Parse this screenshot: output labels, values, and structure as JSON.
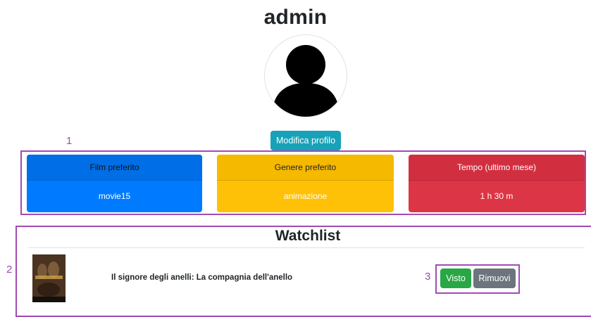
{
  "profile": {
    "username": "admin",
    "edit_label": "Modifica profilo"
  },
  "annotations": [
    "1",
    "2",
    "3"
  ],
  "stats": [
    {
      "label": "Film preferito",
      "value": "movie15",
      "color": "#007bff"
    },
    {
      "label": "Genere preferito",
      "value": "animazione",
      "color": "#ffc107"
    },
    {
      "label": "Tempo (ultimo mese)",
      "value": "1 h 30 m",
      "color": "#dc3545"
    }
  ],
  "watchlist": {
    "title": "Watchlist",
    "items": [
      {
        "title": "Il signore degli anelli: La compagnia dell'anello",
        "poster_icon": "movie-poster",
        "seen_label": "Visto",
        "remove_label": "Rimuovi"
      }
    ]
  },
  "colors": {
    "info": "#17a2b8",
    "success": "#28a745",
    "secondary": "#6c757d",
    "annotation": "#a24bb5"
  }
}
